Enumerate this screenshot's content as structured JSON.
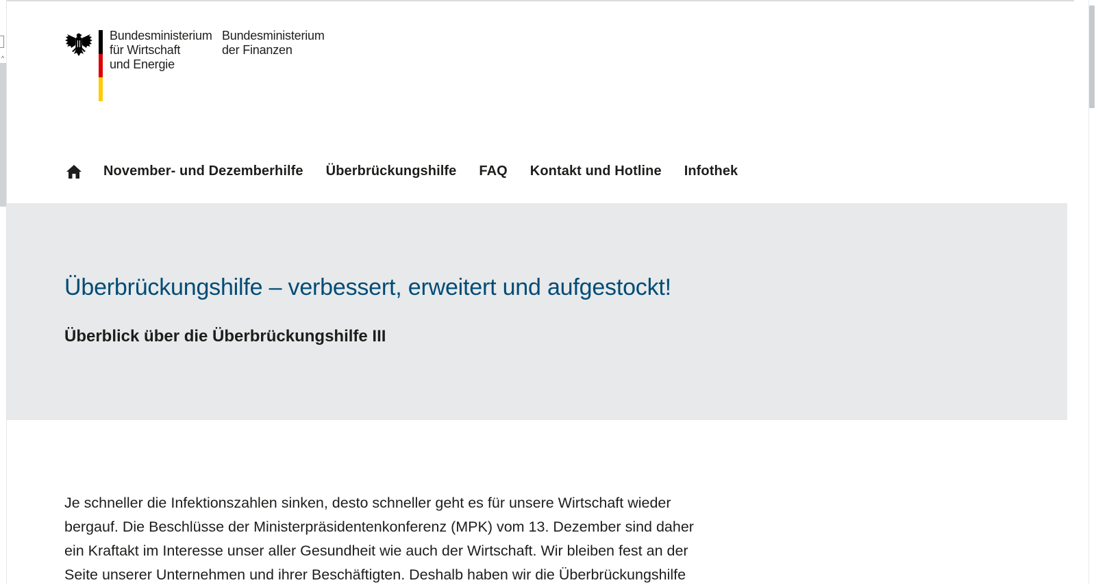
{
  "header": {
    "ministry_1_lines": [
      "Bundesministerium",
      "für Wirtschaft",
      "und Energie"
    ],
    "ministry_2_lines": [
      "Bundesministerium",
      "der Finanzen"
    ],
    "eagle_icon": "federal-eagle-icon",
    "flag_colors": [
      "#000000",
      "#dd0000",
      "#ffcc00"
    ]
  },
  "nav": {
    "home_icon": "home-icon",
    "items": [
      {
        "label": "November- und Dezemberhilfe"
      },
      {
        "label": "Überbrückungshilfe"
      },
      {
        "label": "FAQ"
      },
      {
        "label": "Kontakt und Hotline"
      },
      {
        "label": "Infothek"
      }
    ]
  },
  "hero": {
    "title": "Überbrückungshilfe – verbessert, erweitert und aufgestockt!",
    "subtitle": "Überblick über die Überbrückungshilfe III",
    "background": "#e7e9ea",
    "title_color": "#004b76"
  },
  "content": {
    "intro_lines": [
      "Je schneller die Infektionszahlen sinken, desto schneller geht es für unsere Wirtschaft wieder",
      "bergauf. Die Beschlüsse der Ministerpräsidentenkonferenz (MPK) vom 13. Dezember sind daher",
      "ein Kraftakt im Interesse unser aller Gesundheit wie auch der Wirtschaft. Wir bleiben fest an der",
      "Seite unserer Unternehmen und ihrer Beschäftigten. Deshalb haben wir die Überbrückungshilfe"
    ]
  }
}
